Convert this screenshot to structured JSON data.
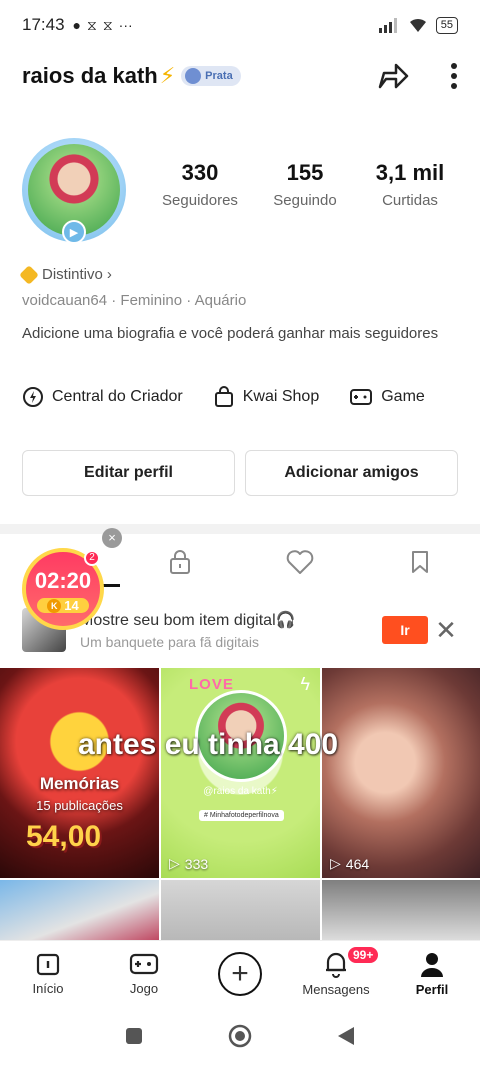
{
  "status_bar": {
    "time": "17:43",
    "battery": "55"
  },
  "header": {
    "username": "raios da kath",
    "bolt": "⚡",
    "rank": "Prata"
  },
  "stats": [
    {
      "value": "330",
      "label": "Seguidores"
    },
    {
      "value": "155",
      "label": "Seguindo"
    },
    {
      "value": "3,1 mil",
      "label": "Curtidas"
    }
  ],
  "profile": {
    "distintivo": "Distintivo",
    "meta": "voidcauan64 · Feminino · Aquário",
    "bio": "Adicione uma biografia e você poderá ganhar mais seguidores"
  },
  "links": [
    "Central do Criador",
    "Kwai Shop",
    "Game"
  ],
  "buttons": {
    "edit": "Editar perfil",
    "add": "Adicionar amigos"
  },
  "timer": {
    "time": "02:20",
    "coins": "14",
    "badge": "2",
    "coin_letter": "K"
  },
  "promo": {
    "title": "Mostre seu bom item digital🎧",
    "subtitle": "Um banquete para fã digitais",
    "go": "Ir"
  },
  "grid": {
    "overlay_text": "antes eu tinha 400",
    "memories_title": "Memórias",
    "memories_sub": "15 publicações",
    "price": "54,00",
    "love": "LOVE",
    "mini_name": "@raios da kath⚡",
    "mini_tag": "# Minhafotodeperfilnova",
    "views_2": "333",
    "views_3": "464"
  },
  "bottom_nav": {
    "items": [
      "Início",
      "Jogo",
      "Mensagens",
      "Perfil"
    ],
    "badge": "99+"
  }
}
